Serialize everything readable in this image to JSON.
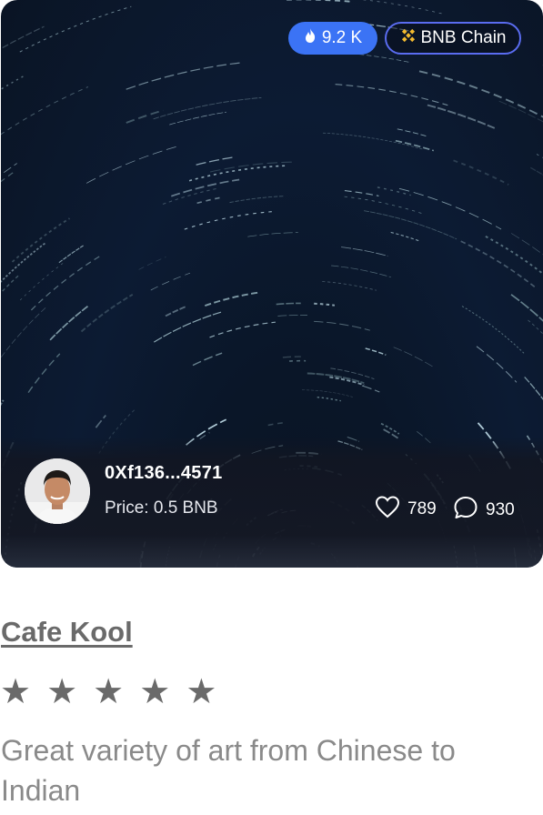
{
  "card": {
    "views": "9.2 K",
    "chain": "BNB Chain",
    "owner_address": "0Xf136...4571",
    "price": "Price: 0.5 BNB",
    "likes": "789",
    "comments": "930",
    "icons": {
      "views": "flame-icon",
      "chain": "bnb-logo-icon",
      "likes": "heart-icon",
      "comments": "comment-icon"
    },
    "colors": {
      "views_badge": "#3b73f5",
      "chain_border": "#5a6cf0",
      "bnb_yellow": "#f3ba2f"
    }
  },
  "listing": {
    "title": "Cafe Kool",
    "rating": 5,
    "stars": [
      "★",
      "★",
      "★",
      "★",
      "★"
    ],
    "description": "Great variety of art from Chinese to Indian"
  }
}
